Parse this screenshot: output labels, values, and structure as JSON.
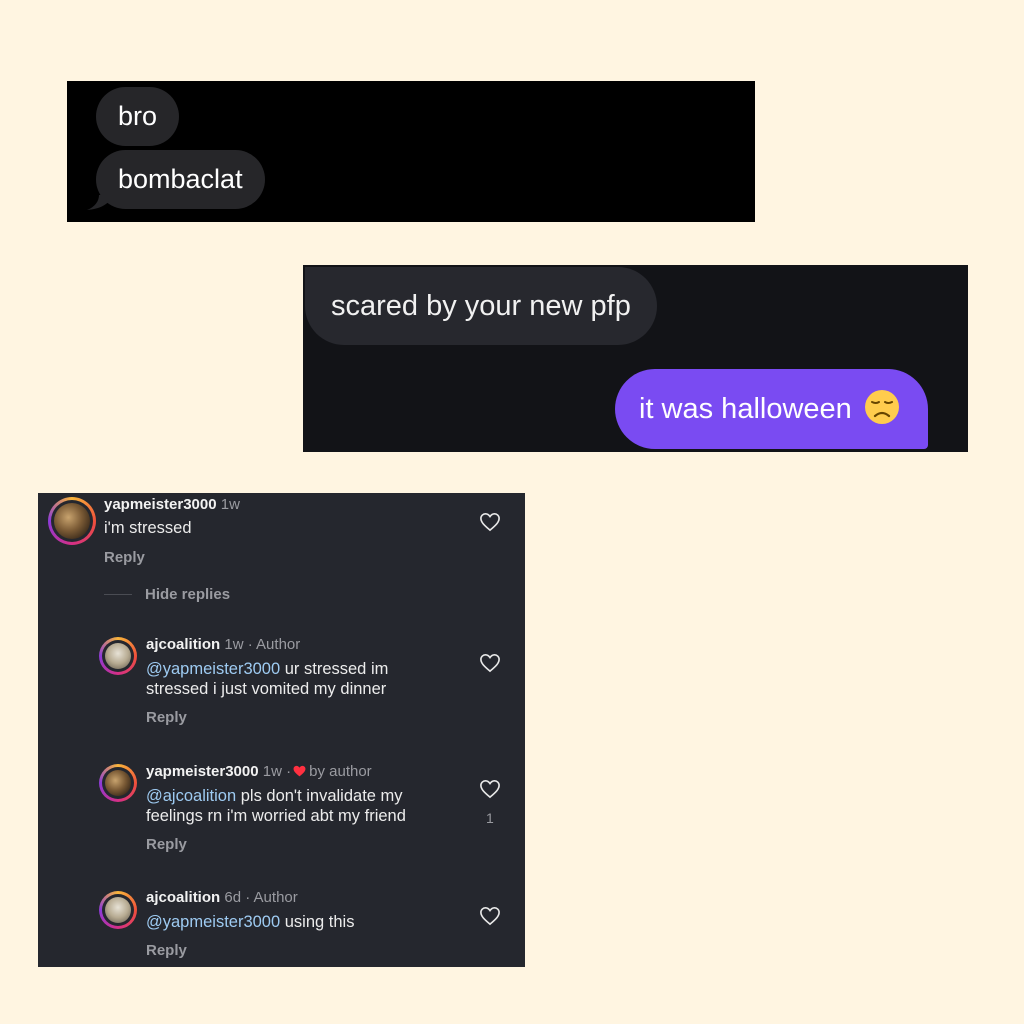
{
  "panel1": {
    "messages": [
      "bro",
      "bombaclat"
    ]
  },
  "panel2": {
    "received": "scared by your new pfp",
    "sent": "it was halloween",
    "sent_emoji": "disappointed-face-emoji"
  },
  "panel3": {
    "hide_replies": "Hide replies",
    "comments": [
      {
        "username": "yapmeister3000",
        "time": "1w",
        "text": "i'm stressed",
        "reply": "Reply"
      },
      {
        "username": "ajcoalition",
        "time": "1w",
        "badge": "· Author",
        "mention": "@yapmeister3000",
        "text": " ur stressed im stressed i just vomited my dinner",
        "reply": "Reply"
      },
      {
        "username": "yapmeister3000",
        "time": "1w",
        "badge_prefix": "·",
        "badge": "by author",
        "mention": "@ajcoalition",
        "text": " pls don't invalidate my feelings rn i'm worried abt my friend",
        "reply": "Reply",
        "likes": "1"
      },
      {
        "username": "ajcoalition",
        "time": "6d",
        "badge": "· Author",
        "mention": "@yapmeister3000",
        "text": " using this",
        "reply": "Reply"
      }
    ]
  },
  "colors": {
    "background": "#fff5e1",
    "sent_bubble": "#7a4bf2",
    "mention": "#9ecbf2",
    "heart_red": "#ff3040"
  }
}
